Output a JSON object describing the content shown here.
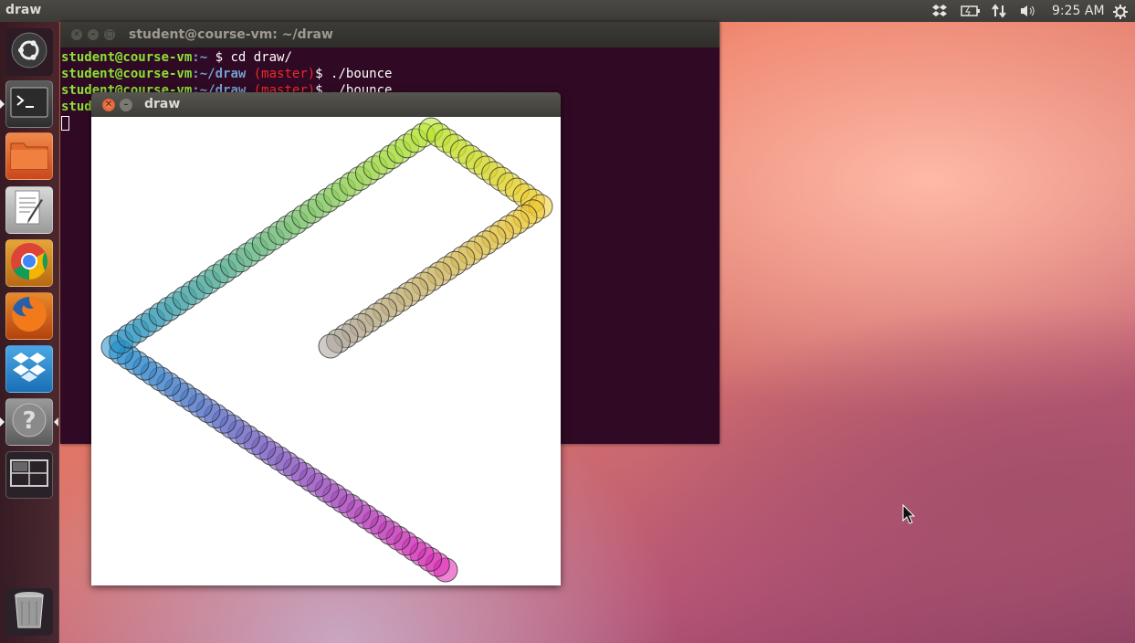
{
  "top_panel": {
    "app_title": "draw",
    "clock": "9:25 AM",
    "tray_icons": [
      "dropbox-icon",
      "battery-icon",
      "network-icon",
      "volume-icon",
      "settings-gear-icon"
    ]
  },
  "launcher": {
    "items": [
      {
        "name": "dash-home",
        "icon": "ubuntu-logo-icon"
      },
      {
        "name": "terminal",
        "icon": "terminal-icon"
      },
      {
        "name": "files",
        "icon": "folder-icon"
      },
      {
        "name": "text-editor",
        "icon": "text-editor-icon"
      },
      {
        "name": "chrome",
        "icon": "chrome-icon"
      },
      {
        "name": "firefox",
        "icon": "firefox-icon"
      },
      {
        "name": "dropbox",
        "icon": "dropbox-icon"
      },
      {
        "name": "help",
        "icon": "help-icon"
      },
      {
        "name": "workspaces",
        "icon": "workspace-switcher-icon"
      },
      {
        "name": "trash",
        "icon": "trash-icon"
      }
    ]
  },
  "terminal": {
    "title": "student@course-vm: ~/draw",
    "lines": [
      {
        "user": "student@course-vm",
        "path": ":~",
        "branch": "",
        "cmd": " $ cd draw/"
      },
      {
        "user": "student@course-vm",
        "path": ":~/draw",
        "branch": " (master)",
        "cmd": "$ ./bounce"
      },
      {
        "user": "student@course-vm",
        "path": ":~/draw",
        "branch": " (master)",
        "cmd": "$ ./bounce"
      },
      {
        "user": "stud",
        "path": "",
        "branch": "",
        "cmd": ""
      }
    ]
  },
  "draw_window": {
    "title": "draw",
    "trail_colors": {
      "start": "#e020b0",
      "corner_left": "#1e8cc8",
      "corner_top": "#b4e428",
      "corner_right": "#f0c828",
      "end": "#a8a098"
    }
  }
}
